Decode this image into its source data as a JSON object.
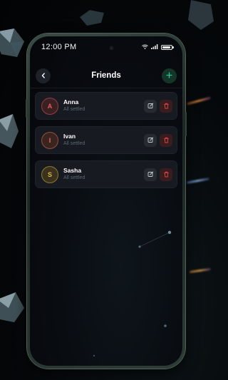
{
  "status_bar": {
    "time": "12:00 PM",
    "battery_level": 0.9
  },
  "header": {
    "title": "Friends",
    "back_icon": "chevron-left-icon",
    "add_icon": "plus-icon"
  },
  "friends": [
    {
      "initial": "A",
      "name": "Anna",
      "status": "All settled",
      "accent": "#e05c5c",
      "avatar_bg": "#3a1f23"
    },
    {
      "initial": "I",
      "name": "Ivan",
      "status": "All settled",
      "accent": "#e0755c",
      "avatar_bg": "#3a2420"
    },
    {
      "initial": "S",
      "name": "Sasha",
      "status": "All settled",
      "accent": "#d7b64a",
      "avatar_bg": "#3a321a"
    }
  ],
  "colors": {
    "add_accent": "#27c49a",
    "delete_accent": "#e04848",
    "edit_icon": "#c8ced3"
  }
}
